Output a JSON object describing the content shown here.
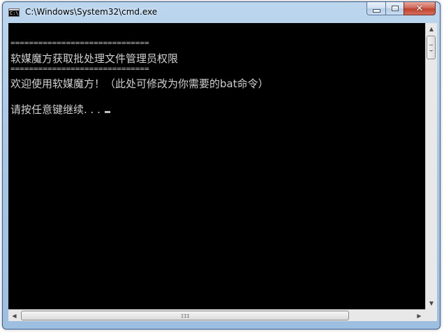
{
  "window": {
    "title": "C:\\Windows\\System32\\cmd.exe",
    "icon": "cmd-icon",
    "icon_text": "C:\\"
  },
  "caption_buttons": {
    "minimize_icon": "minimize-icon",
    "maximize_icon": "maximize-icon",
    "close_icon": "close-icon",
    "close_glyph": "✕"
  },
  "console": {
    "background": "#000000",
    "foreground": "#c0c0c0",
    "lines": [
      "==============================",
      "软媒魔方获取批处理文件管理员权限",
      "==============================",
      "欢迎使用软媒魔方！（此处可修改为你需要的bat命令）",
      "请按任意键继续. . ."
    ]
  },
  "scrollbars": {
    "up_arrow": "▲",
    "down_arrow": "▼",
    "left_arrow": "◀",
    "right_arrow": "▶",
    "grip": "III"
  }
}
